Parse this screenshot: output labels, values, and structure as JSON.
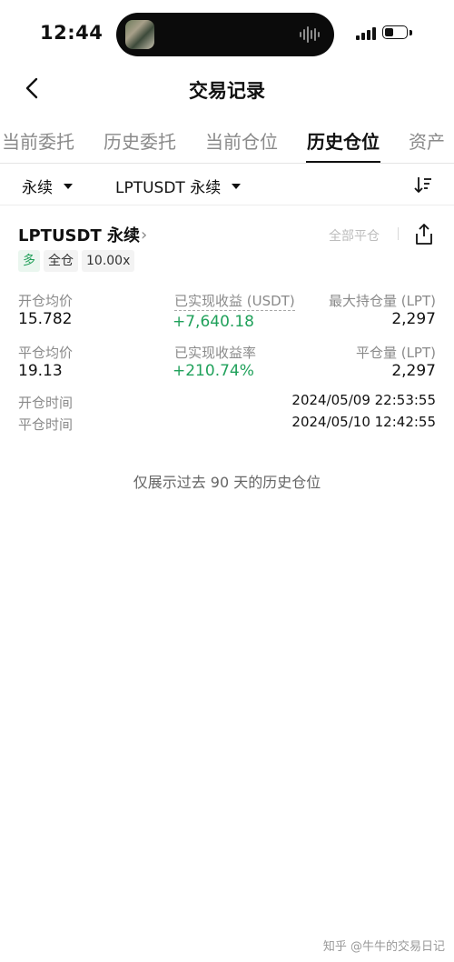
{
  "status_bar": {
    "time": "12:44"
  },
  "header": {
    "title": "交易记录"
  },
  "tabs": [
    {
      "label": "当前委托"
    },
    {
      "label": "历史委托"
    },
    {
      "label": "当前仓位"
    },
    {
      "label": "历史仓位",
      "active": true
    },
    {
      "label": "资产"
    }
  ],
  "filters": {
    "type": "永续",
    "symbol": "LPTUSDT 永续"
  },
  "position": {
    "title": "LPTUSDT 永续",
    "close_all": "全部平仓",
    "tags": [
      "多",
      "全仓",
      "10.00x"
    ],
    "open_avg_label": "开仓均价",
    "open_avg_value": "15.782",
    "realized_pnl_label": "已实现收益 (USDT)",
    "realized_pnl_value": "+7,640.18",
    "max_hold_label": "最大持仓量 (LPT)",
    "max_hold_value": "2,297",
    "close_avg_label": "平仓均价",
    "close_avg_value": "19.13",
    "realized_rate_label": "已实现收益率",
    "realized_rate_value": "+210.74%",
    "close_qty_label": "平仓量 (LPT)",
    "close_qty_value": "2,297",
    "open_time_label": "开仓时间",
    "open_time_value": "2024/05/09 22:53:55",
    "close_time_label": "平仓时间",
    "close_time_value": "2024/05/10 12:42:55"
  },
  "note": "仅展示过去 90 天的历史仓位",
  "watermark": "知乎 @牛牛的交易日记",
  "colors": {
    "profit": "#20a15b",
    "tag_green": "#22a05a",
    "muted": "#8a8a8a"
  }
}
